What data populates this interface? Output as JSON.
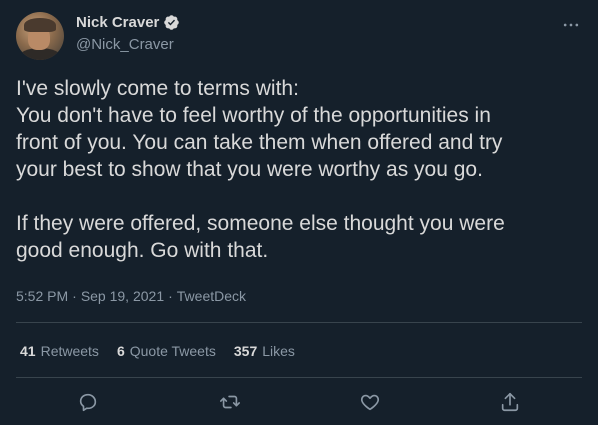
{
  "author": {
    "name": "Nick Craver",
    "handle": "@Nick_Craver",
    "verified": true
  },
  "tweet": {
    "text": "I've slowly come to terms with:\nYou don't have to feel worthy of the opportunities in\nfront of you. You can take them when offered and try\nyour best to show that you were worthy as you go.\n\nIf they were offered, someone else thought you were\ngood enough. Go with that.",
    "time": "5:52 PM",
    "date": "Sep 19, 2021",
    "source": "TweetDeck",
    "separator": "·"
  },
  "stats": {
    "retweets_count": "41",
    "retweets_label": "Retweets",
    "quotes_count": "6",
    "quotes_label": "Quote Tweets",
    "likes_count": "357",
    "likes_label": "Likes"
  },
  "colors": {
    "background": "#15202b",
    "text": "#d9d9d9",
    "secondary": "#8b98a5",
    "divider": "#38444d",
    "verified_blue": "#1d9bf0"
  },
  "icons": {
    "verified": "verified-badge-icon",
    "more": "more-horizontal-icon",
    "reply": "reply-icon",
    "retweet": "retweet-icon",
    "like": "like-heart-icon",
    "share": "share-icon"
  }
}
